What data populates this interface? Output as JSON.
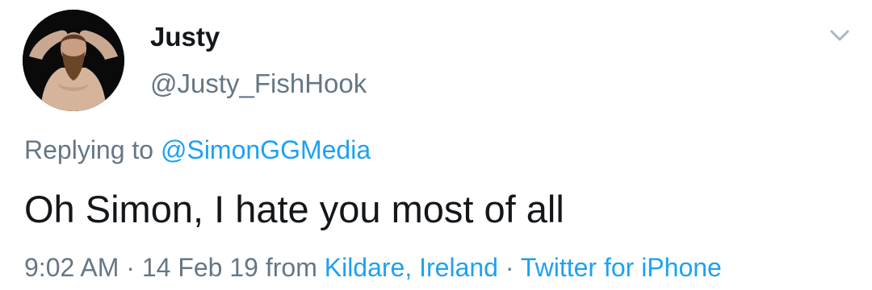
{
  "user": {
    "display_name": "Justy",
    "handle": "@Justy_FishHook"
  },
  "reply": {
    "prefix": "Replying to ",
    "mention": "@SimonGGMedia"
  },
  "tweet": {
    "text": "Oh Simon, I hate you most of all"
  },
  "meta": {
    "time": "9:02 AM",
    "sep1": " · ",
    "date": "14 Feb 19",
    "from": " from ",
    "location": "Kildare, Ireland",
    "sep2": " · ",
    "source": "Twitter for iPhone"
  },
  "icons": {
    "menu": "chevron-down-icon",
    "avatar": "avatar-photo"
  },
  "colors": {
    "text": "#14171a",
    "secondary": "#657786",
    "link": "#1da1f2",
    "chevron": "#aab8c2"
  }
}
